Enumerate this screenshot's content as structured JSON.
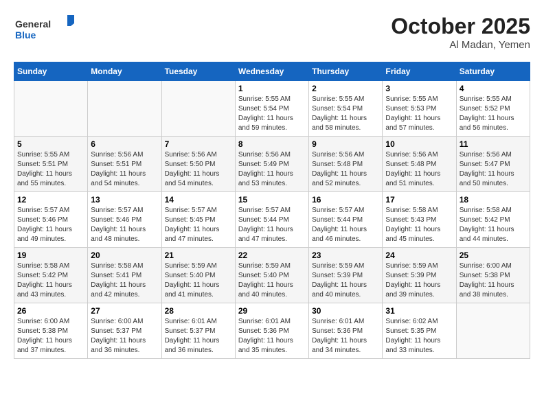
{
  "logo": {
    "general": "General",
    "blue": "Blue"
  },
  "header": {
    "month": "October 2025",
    "location": "Al Madan, Yemen"
  },
  "weekdays": [
    "Sunday",
    "Monday",
    "Tuesday",
    "Wednesday",
    "Thursday",
    "Friday",
    "Saturday"
  ],
  "weeks": [
    [
      {
        "day": "",
        "info": ""
      },
      {
        "day": "",
        "info": ""
      },
      {
        "day": "",
        "info": ""
      },
      {
        "day": "1",
        "info": "Sunrise: 5:55 AM\nSunset: 5:54 PM\nDaylight: 11 hours\nand 59 minutes."
      },
      {
        "day": "2",
        "info": "Sunrise: 5:55 AM\nSunset: 5:54 PM\nDaylight: 11 hours\nand 58 minutes."
      },
      {
        "day": "3",
        "info": "Sunrise: 5:55 AM\nSunset: 5:53 PM\nDaylight: 11 hours\nand 57 minutes."
      },
      {
        "day": "4",
        "info": "Sunrise: 5:55 AM\nSunset: 5:52 PM\nDaylight: 11 hours\nand 56 minutes."
      }
    ],
    [
      {
        "day": "5",
        "info": "Sunrise: 5:55 AM\nSunset: 5:51 PM\nDaylight: 11 hours\nand 55 minutes."
      },
      {
        "day": "6",
        "info": "Sunrise: 5:56 AM\nSunset: 5:51 PM\nDaylight: 11 hours\nand 54 minutes."
      },
      {
        "day": "7",
        "info": "Sunrise: 5:56 AM\nSunset: 5:50 PM\nDaylight: 11 hours\nand 54 minutes."
      },
      {
        "day": "8",
        "info": "Sunrise: 5:56 AM\nSunset: 5:49 PM\nDaylight: 11 hours\nand 53 minutes."
      },
      {
        "day": "9",
        "info": "Sunrise: 5:56 AM\nSunset: 5:48 PM\nDaylight: 11 hours\nand 52 minutes."
      },
      {
        "day": "10",
        "info": "Sunrise: 5:56 AM\nSunset: 5:48 PM\nDaylight: 11 hours\nand 51 minutes."
      },
      {
        "day": "11",
        "info": "Sunrise: 5:56 AM\nSunset: 5:47 PM\nDaylight: 11 hours\nand 50 minutes."
      }
    ],
    [
      {
        "day": "12",
        "info": "Sunrise: 5:57 AM\nSunset: 5:46 PM\nDaylight: 11 hours\nand 49 minutes."
      },
      {
        "day": "13",
        "info": "Sunrise: 5:57 AM\nSunset: 5:46 PM\nDaylight: 11 hours\nand 48 minutes."
      },
      {
        "day": "14",
        "info": "Sunrise: 5:57 AM\nSunset: 5:45 PM\nDaylight: 11 hours\nand 47 minutes."
      },
      {
        "day": "15",
        "info": "Sunrise: 5:57 AM\nSunset: 5:44 PM\nDaylight: 11 hours\nand 47 minutes."
      },
      {
        "day": "16",
        "info": "Sunrise: 5:57 AM\nSunset: 5:44 PM\nDaylight: 11 hours\nand 46 minutes."
      },
      {
        "day": "17",
        "info": "Sunrise: 5:58 AM\nSunset: 5:43 PM\nDaylight: 11 hours\nand 45 minutes."
      },
      {
        "day": "18",
        "info": "Sunrise: 5:58 AM\nSunset: 5:42 PM\nDaylight: 11 hours\nand 44 minutes."
      }
    ],
    [
      {
        "day": "19",
        "info": "Sunrise: 5:58 AM\nSunset: 5:42 PM\nDaylight: 11 hours\nand 43 minutes."
      },
      {
        "day": "20",
        "info": "Sunrise: 5:58 AM\nSunset: 5:41 PM\nDaylight: 11 hours\nand 42 minutes."
      },
      {
        "day": "21",
        "info": "Sunrise: 5:59 AM\nSunset: 5:40 PM\nDaylight: 11 hours\nand 41 minutes."
      },
      {
        "day": "22",
        "info": "Sunrise: 5:59 AM\nSunset: 5:40 PM\nDaylight: 11 hours\nand 40 minutes."
      },
      {
        "day": "23",
        "info": "Sunrise: 5:59 AM\nSunset: 5:39 PM\nDaylight: 11 hours\nand 40 minutes."
      },
      {
        "day": "24",
        "info": "Sunrise: 5:59 AM\nSunset: 5:39 PM\nDaylight: 11 hours\nand 39 minutes."
      },
      {
        "day": "25",
        "info": "Sunrise: 6:00 AM\nSunset: 5:38 PM\nDaylight: 11 hours\nand 38 minutes."
      }
    ],
    [
      {
        "day": "26",
        "info": "Sunrise: 6:00 AM\nSunset: 5:38 PM\nDaylight: 11 hours\nand 37 minutes."
      },
      {
        "day": "27",
        "info": "Sunrise: 6:00 AM\nSunset: 5:37 PM\nDaylight: 11 hours\nand 36 minutes."
      },
      {
        "day": "28",
        "info": "Sunrise: 6:01 AM\nSunset: 5:37 PM\nDaylight: 11 hours\nand 36 minutes."
      },
      {
        "day": "29",
        "info": "Sunrise: 6:01 AM\nSunset: 5:36 PM\nDaylight: 11 hours\nand 35 minutes."
      },
      {
        "day": "30",
        "info": "Sunrise: 6:01 AM\nSunset: 5:36 PM\nDaylight: 11 hours\nand 34 minutes."
      },
      {
        "day": "31",
        "info": "Sunrise: 6:02 AM\nSunset: 5:35 PM\nDaylight: 11 hours\nand 33 minutes."
      },
      {
        "day": "",
        "info": ""
      }
    ]
  ]
}
